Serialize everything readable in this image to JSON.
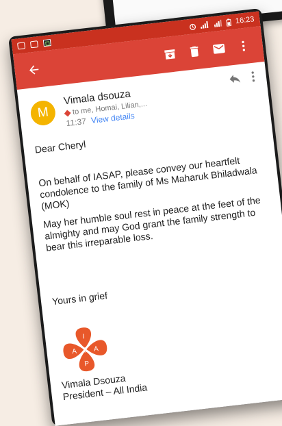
{
  "status_bar": {
    "time": "16:23"
  },
  "email": {
    "sender_name": "Vimala dsouza",
    "avatar_letter": "M",
    "recipients": "to me, Homai, Lilian,...",
    "time": "11:37",
    "view_details": "View details",
    "greeting": "Dear Cheryl",
    "paragraph1": "On behalf of IASAP, please convey our heartfelt condolence to the family of Ms Maharuk Bhiladwala (MOK)",
    "paragraph2": "May her humble soul rest in peace at the feet of the almighty and may God grant the family strength to bear this irreparable loss.",
    "closing": "Yours in grief",
    "signature_name": "Vimala Dsouza",
    "signature_title": "President – All India",
    "logo_letters": [
      "I",
      "A",
      "S",
      "A",
      "P"
    ]
  },
  "colors": {
    "status_bar": "#c9311f",
    "toolbar": "#db4437",
    "avatar": "#f4b400",
    "link": "#4285f4",
    "logo": "#e8582a",
    "background": "#f6ede4"
  },
  "icons": {
    "toolbar": [
      "back-arrow-icon",
      "archive-icon",
      "delete-icon",
      "mail-icon",
      "more-vert-icon"
    ],
    "header": [
      "reply-icon",
      "more-vert-icon"
    ]
  }
}
